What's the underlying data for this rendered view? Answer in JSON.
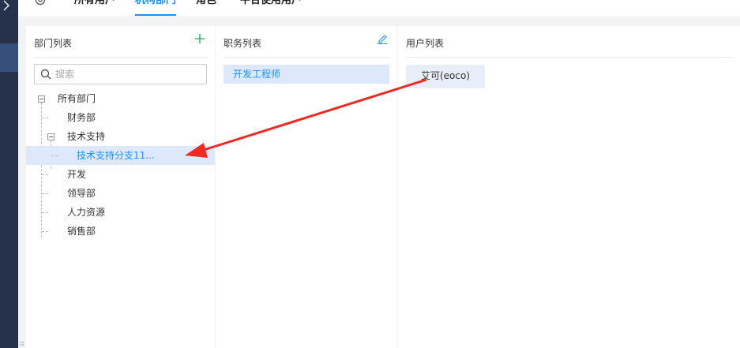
{
  "tabs": [
    {
      "label": "所有用户"
    },
    {
      "label": "机构部门"
    },
    {
      "label": "角色"
    },
    {
      "label": "平台使用用户"
    }
  ],
  "dept": {
    "title": "部门列表",
    "search_placeholder": "搜索",
    "nodes": [
      {
        "label": "所有部门"
      },
      {
        "label": "财务部"
      },
      {
        "label": "技术支持"
      },
      {
        "label": "技术支持分支11..."
      },
      {
        "label": "开发"
      },
      {
        "label": "领导部"
      },
      {
        "label": "人力资源"
      },
      {
        "label": "销售部"
      }
    ]
  },
  "positions": {
    "title": "职务列表",
    "items": [
      {
        "label": "开发工程师"
      }
    ]
  },
  "users": {
    "title": "用户列表",
    "items": [
      {
        "label": "艾可(eoco)"
      }
    ]
  },
  "colors": {
    "accent": "#1890ff",
    "add_icon": "#2fbf71",
    "sidebar": "#25324a",
    "annotation_arrow": "#ee2b22"
  }
}
